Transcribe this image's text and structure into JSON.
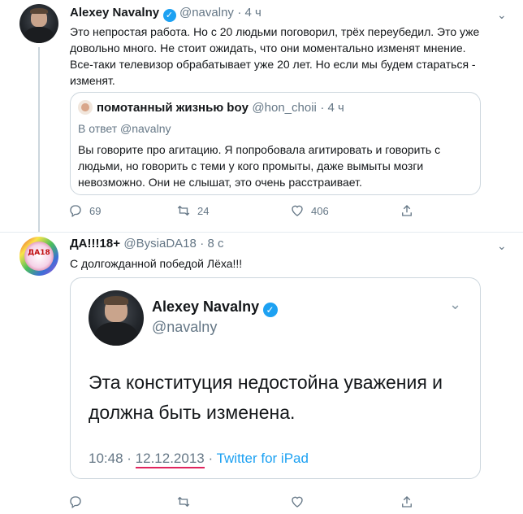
{
  "tweet1": {
    "name": "Alexey Navalny",
    "handle": "@navalny",
    "time": "· 4 ч",
    "text": "Это непростая работа. Но с 20 людьми поговорил, трёх переубедил. Это уже довольно много. Не стоит ожидать, что они моментально изменят мнение. Все-таки телевизор обрабатывает уже 20 лет. Но если мы будем стараться - изменят.",
    "quote": {
      "name": "помотанный жизнью boy",
      "handle": "@hon_choii",
      "time": "· 4 ч",
      "reply_to": "В ответ @navalny",
      "text": "Вы говорите про агитацию. Я попробовала агитировать и говорить с людьми, но говорить с теми у кого промыты, даже вымыты мозги невозможно. Они не слышат, это очень расстраивает."
    },
    "actions": {
      "replies": "69",
      "retweets": "24",
      "likes": "406"
    }
  },
  "tweet2": {
    "name": "ДА!!!18+",
    "handle": "@BysiaDA18",
    "time": "· 8 с",
    "avatar_text": "ДА18",
    "text": "С долгожданной победой Лёха!!!",
    "embedded": {
      "name": "Alexey Navalny",
      "handle": "@navalny",
      "text": "Эта конституция недостойна уважения и должна быть изменена.",
      "time": "10:48",
      "date": "12.12.2013",
      "source": "Twitter for iPad"
    }
  },
  "colors": {
    "accent": "#1da1f2",
    "muted": "#657786",
    "underline": "#e0245e"
  },
  "icons": [
    "chevron-down-icon",
    "reply-icon",
    "retweet-icon",
    "like-icon",
    "share-icon",
    "verified-icon"
  ]
}
